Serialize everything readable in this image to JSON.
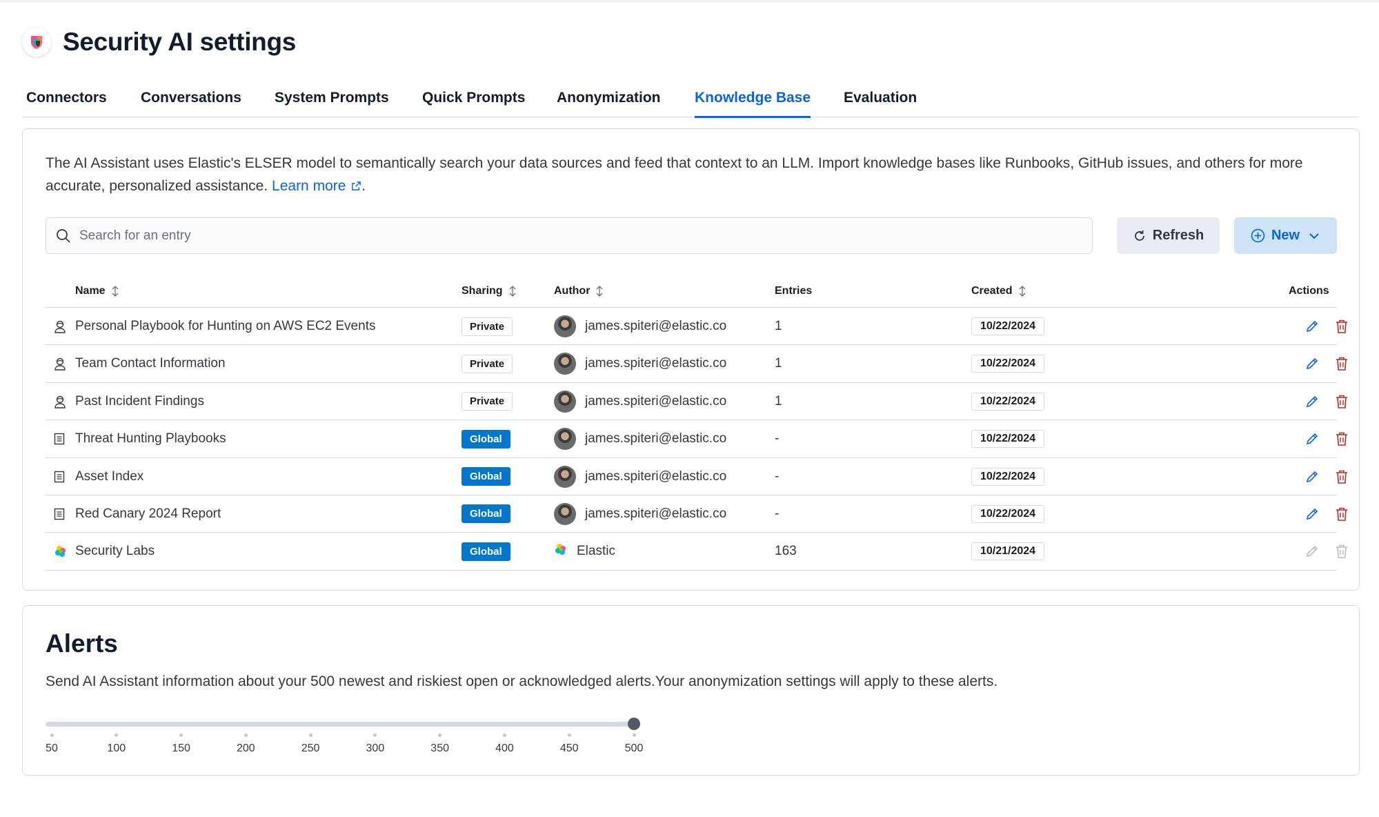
{
  "header": {
    "title": "Security AI settings"
  },
  "tabs": [
    {
      "label": "Connectors",
      "active": false
    },
    {
      "label": "Conversations",
      "active": false
    },
    {
      "label": "System Prompts",
      "active": false
    },
    {
      "label": "Quick Prompts",
      "active": false
    },
    {
      "label": "Anonymization",
      "active": false
    },
    {
      "label": "Knowledge Base",
      "active": true
    },
    {
      "label": "Evaluation",
      "active": false
    }
  ],
  "kb": {
    "description": "The AI Assistant uses Elastic's ELSER model to semantically search your data sources and feed that context to an LLM. Import knowledge bases like Runbooks, GitHub issues, and others for more accurate, personalized assistance.",
    "learn_more": "Learn more",
    "search_placeholder": "Search for an entry",
    "refresh_label": "Refresh",
    "new_label": "New",
    "columns": {
      "name": "Name",
      "sharing": "Sharing",
      "author": "Author",
      "entries": "Entries",
      "created": "Created",
      "actions": "Actions"
    },
    "rows": [
      {
        "icon": "user-icon",
        "name": "Personal Playbook for Hunting on AWS EC2 Events",
        "sharing": "Private",
        "author": "james.spiteri@elastic.co",
        "entries": "1",
        "created": "10/22/2024",
        "editable": true
      },
      {
        "icon": "user-icon",
        "name": "Team Contact Information",
        "sharing": "Private",
        "author": "james.spiteri@elastic.co",
        "entries": "1",
        "created": "10/22/2024",
        "editable": true
      },
      {
        "icon": "user-icon",
        "name": "Past Incident Findings",
        "sharing": "Private",
        "author": "james.spiteri@elastic.co",
        "entries": "1",
        "created": "10/22/2024",
        "editable": true
      },
      {
        "icon": "document-icon",
        "name": "Threat Hunting Playbooks",
        "sharing": "Global",
        "author": "james.spiteri@elastic.co",
        "entries": "-",
        "created": "10/22/2024",
        "editable": true
      },
      {
        "icon": "document-icon",
        "name": "Asset Index",
        "sharing": "Global",
        "author": "james.spiteri@elastic.co",
        "entries": "-",
        "created": "10/22/2024",
        "editable": true
      },
      {
        "icon": "document-icon",
        "name": "Red Canary 2024 Report",
        "sharing": "Global",
        "author": "james.spiteri@elastic.co",
        "entries": "-",
        "created": "10/22/2024",
        "editable": true
      },
      {
        "icon": "elastic-logo-icon",
        "name": "Security Labs",
        "sharing": "Global",
        "author": "Elastic",
        "entries": "163",
        "created": "10/21/2024",
        "editable": false
      }
    ]
  },
  "alerts": {
    "title": "Alerts",
    "description": "Send AI Assistant information about your 500 newest and riskiest open or acknowledged alerts.Your anonymization settings will apply to these alerts.",
    "slider_value": 500,
    "ticks": [
      "50",
      "100",
      "150",
      "200",
      "250",
      "300",
      "350",
      "400",
      "450",
      "500"
    ]
  },
  "colors": {
    "accent": "#0b64dd",
    "global_badge": "#0077cc",
    "delete": "#bd271e"
  }
}
